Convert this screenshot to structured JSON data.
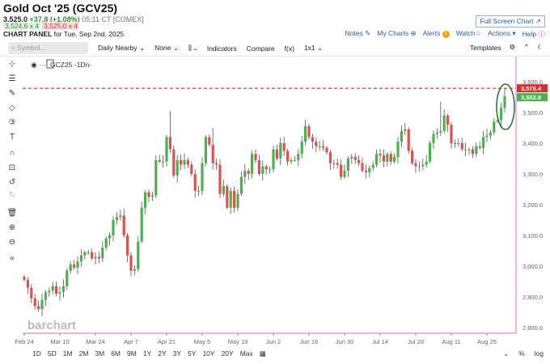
{
  "header": {
    "title": "Gold Oct '25 (GCV25)",
    "last": "3,525.0",
    "change": "+37.8 (+1.08%)",
    "time": "05:11 CT [COMEX]",
    "bid": "3,524.6 x 4",
    "ask": "3,525.0 x 4",
    "panel_label": "CHART PANEL",
    "panel_date": "for Tue, Sep 2nd, 2025"
  },
  "links": {
    "fullscreen": "Full Screen Chart ↗",
    "notes": "Notes",
    "mycharts": "My Charts",
    "alerts": "Alerts",
    "watch": "Watch",
    "actions": "Actions ▾",
    "help": "Help"
  },
  "toolbar": {
    "symbol_placeholder": "Symbol...",
    "period": "Daily Nearby ⌄",
    "overlay": "None ⌄",
    "bars": "⌄",
    "indicators": "Indicators",
    "compare": "Compare",
    "fx": "f(x)",
    "layout": "1x1 ⌄",
    "templates": "Templates"
  },
  "legend": {
    "symbol": "GCZ25 -1Dn-"
  },
  "ranges": [
    "1D",
    "5D",
    "1M",
    "2M",
    "3M",
    "6M",
    "9M",
    "1Y",
    "2Y",
    "3Y",
    "5Y",
    "10Y",
    "20Y",
    "Max"
  ],
  "bottom_right": {
    "pct": "%",
    "log": "log"
  },
  "watermark": "barchart",
  "colors": {
    "up": "#4caf50",
    "down": "#e05050",
    "accent": "#2a5d9f",
    "border": "#d76fd1",
    "ref_line": "#d32f2f"
  },
  "chart_data": {
    "type": "candlestick",
    "ylim": [
      2780,
      3640
    ],
    "y_ticks": [
      2800,
      2900,
      3000,
      3100,
      3200,
      3300,
      3400,
      3500,
      3600
    ],
    "y_tick_labels": [
      "2,800.0",
      "2,900.0",
      "3,000.0",
      "3,100.0",
      "3,200.0",
      "3,300.0",
      "3,400.0",
      "3,500.0",
      "3,600.0"
    ],
    "x_tick_labels": [
      "Feb 24",
      "Mar 10",
      "Mar 24",
      "Apr 7",
      "Apr 21",
      "May 5",
      "May 19",
      "Jun 2",
      "Jun 16",
      "Jun 30",
      "Jul 14",
      "Jul 28",
      "Aug 11",
      "Aug 25"
    ],
    "start_open": 2965,
    "closes": [
      2955,
      2930,
      2895,
      2870,
      2860,
      2890,
      2915,
      2920,
      2935,
      2910,
      2915,
      2935,
      2985,
      3005,
      2995,
      3015,
      3035,
      3045,
      3045,
      3025,
      3030,
      3025,
      3060,
      3090,
      3100,
      3150,
      3160,
      3165,
      3100,
      3035,
      2985,
      2990,
      3080,
      3190,
      3240,
      3225,
      3230,
      3345,
      3340,
      3340,
      3420,
      3380,
      3295,
      3345,
      3330,
      3345,
      3330,
      3300,
      3245,
      3245,
      3335,
      3420,
      3395,
      3335,
      3330,
      3235,
      3260,
      3190,
      3245,
      3190,
      3235,
      3290,
      3310,
      3300,
      3365,
      3345,
      3300,
      3325,
      3315,
      3315,
      3380,
      3350,
      3400,
      3375,
      3340,
      3345,
      3345,
      3365,
      3405,
      3455,
      3420,
      3405,
      3390,
      3390,
      3385,
      3370,
      3335,
      3335,
      3330,
      3290,
      3310,
      3350,
      3355,
      3345,
      3335,
      3310,
      3305,
      3320,
      3330,
      3365,
      3360,
      3340,
      3365,
      3340,
      3355,
      3405,
      3440,
      3445,
      3375,
      3335,
      3325,
      3325,
      3330,
      3340,
      3400,
      3430,
      3435,
      3440,
      3490,
      3460,
      3400,
      3400,
      3400,
      3380,
      3380,
      3380,
      3365,
      3390,
      3385,
      3420,
      3425,
      3435,
      3470,
      3475,
      3515,
      3552.8
    ],
    "reference_line": {
      "value": 3578.4,
      "label": "3,578.4"
    },
    "last_price": {
      "value": 3552.8,
      "label": "3,552.8"
    }
  }
}
